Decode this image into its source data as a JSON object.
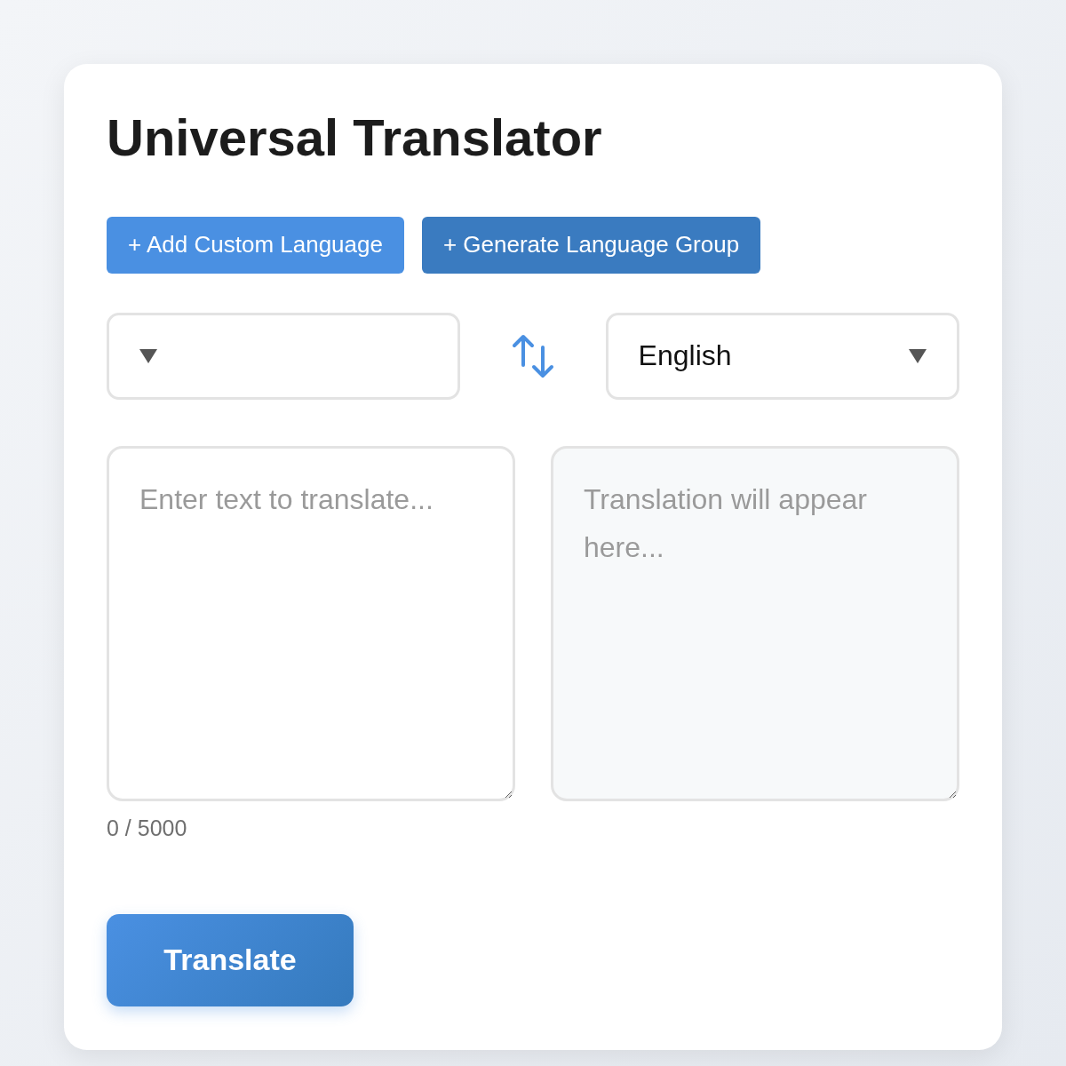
{
  "title": "Universal Translator",
  "actions": [
    {
      "label": "+ Add Custom Language",
      "kind": "light"
    },
    {
      "label": "+ Generate Language Group",
      "kind": "dark"
    }
  ],
  "target_select": {
    "value": "English"
  },
  "input": {
    "placeholder": "Enter text to translate..."
  },
  "output": {
    "placeholder": "Translation will appear here..."
  },
  "counter": "0 / 5000",
  "translate_button": "Translate"
}
